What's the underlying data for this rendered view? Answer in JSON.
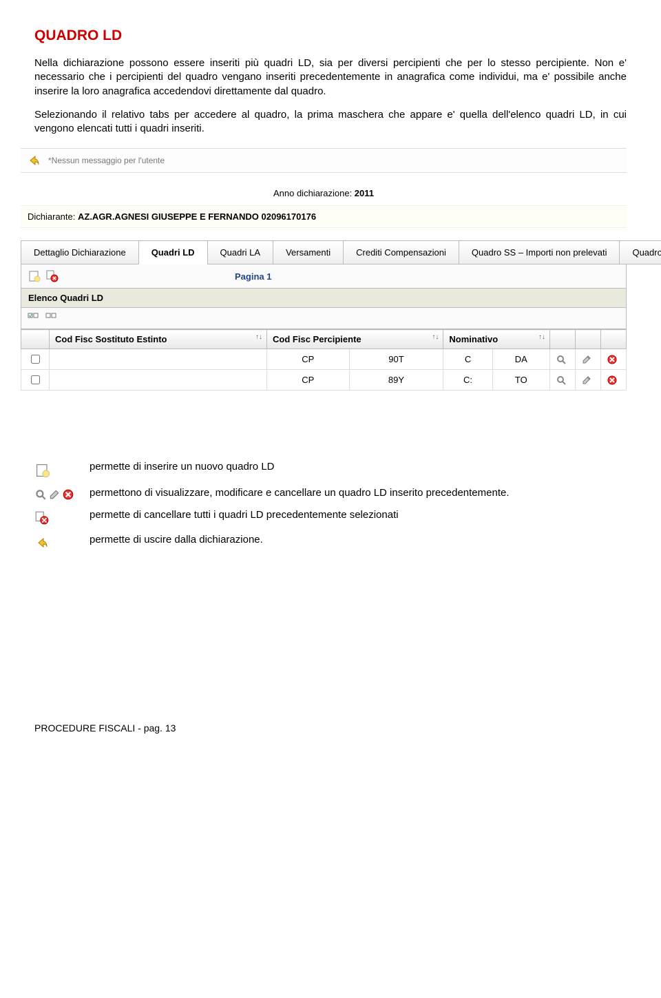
{
  "title": "QUADRO LD",
  "para1": "Nella dichiarazione possono essere inseriti più quadri LD, sia  per diversi percipienti che per lo stesso  percipiente.  Non  e'  necessario  che  i  percipienti  del  quadro  vengano  inseriti precedentemente in  anagrafica come individui, ma e' possibile anche inserire la loro anagrafica accedendovi  direttamente dal quadro.",
  "para2": "Selezionando il relativo tabs per accedere al quadro, la prima maschera che appare e' quella dell'elenco quadri LD, in cui vengono elencati tutti i quadri inseriti.",
  "screenshot": {
    "msg": "*Nessun messaggio per l'utente",
    "year_label": "Anno dichiarazione: ",
    "year_value": "2011",
    "dich_label": "Dichiarante: ",
    "dich_value": "AZ.AGR.AGNESI GIUSEPPE E FERNANDO   02096170176",
    "tabs": [
      "Dettaglio Dichiarazione",
      "Quadri LD",
      "Quadri LA",
      "Versamenti",
      "Crediti Compensazioni",
      "Quadro SS – Importi non prelevati",
      "Quadro SY"
    ],
    "active_tab": 1,
    "page_label": "Pagina 1",
    "section_title": "Elenco Quadri LD",
    "cols": [
      "Cod Fisc Sostituto Estinto",
      "Cod Fisc Percipiente",
      "Nominativo"
    ],
    "rows": [
      {
        "c1": "",
        "c2a": "CP",
        "c2b": "90T",
        "c3a": "C",
        "c3b": "DA"
      },
      {
        "c1": "",
        "c2a": "CP",
        "c2b": "89Y",
        "c3a": "C:",
        "c3b": "TO"
      }
    ]
  },
  "desc": {
    "d1": "permette di inserire un nuovo quadro LD",
    "d2": "permettono di visualizzare, modificare e cancellare un quadro LD inserito precedentemente.",
    "d3": "permette di cancellare tutti i quadri LD precedentemente selezionati",
    "d4": "permette di uscire dalla dichiarazione."
  },
  "footer": "PROCEDURE FISCALI - pag. 13"
}
